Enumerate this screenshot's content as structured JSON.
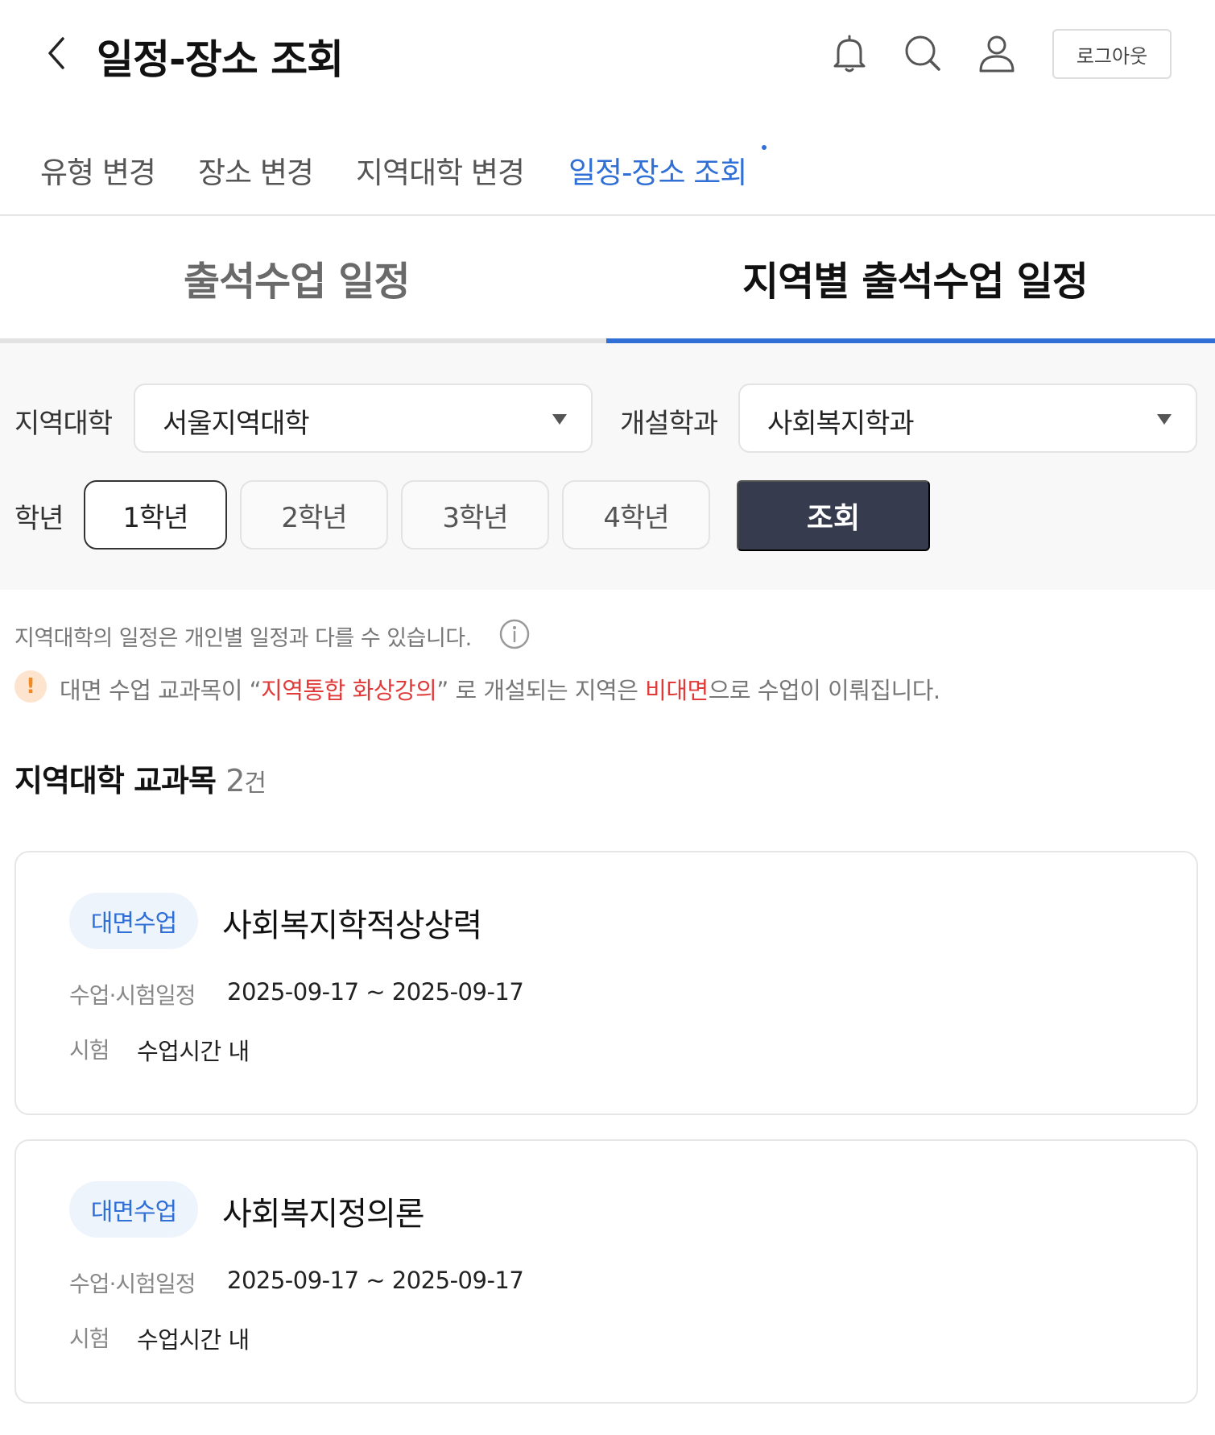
{
  "header": {
    "title": "일정-장소 조회",
    "logout_label": "로그아웃",
    "icons": [
      "back-chevron-icon",
      "bell-icon",
      "search-icon",
      "user-icon"
    ]
  },
  "subnav": {
    "items": [
      {
        "label": "유형 변경",
        "active": false
      },
      {
        "label": "장소 변경",
        "active": false
      },
      {
        "label": "지역대학 변경",
        "active": false
      },
      {
        "label": "일정-장소 조회",
        "active": true
      }
    ]
  },
  "tabs": {
    "items": [
      {
        "label": "출석수업 일정",
        "active": false
      },
      {
        "label": "지역별 출석수업 일정",
        "active": true
      }
    ]
  },
  "filter": {
    "region_label": "지역대학",
    "region_value": "서울지역대학",
    "dept_label": "개설학과",
    "dept_value": "사회복지학과",
    "grade_label": "학년",
    "grades": [
      "1학년",
      "2학년",
      "3학년",
      "4학년"
    ],
    "selected_grade": "1학년",
    "search_label": "조회"
  },
  "notices": {
    "line1": "지역대학의 일정은 개인별 일정과 다를 수 있습니다.",
    "line2_prefix": "대면 수업 교과목이 “",
    "line2_highlight1": "지역통합 화상강의",
    "line2_mid": "” 로 개설되는 지역은 ",
    "line2_highlight2": "비대면",
    "line2_suffix": "으로 수업이 이뤄집니다."
  },
  "section": {
    "title": "지역대학 교과목",
    "count": "2",
    "count_unit": "건"
  },
  "courses": [
    {
      "badge": "대면수업",
      "name": "사회복지학적상상력",
      "schedule_label": "수업·시험일정",
      "schedule_value": "2025-09-17 ~ 2025-09-17",
      "exam_label": "시험",
      "exam_value": "수업시간 내"
    },
    {
      "badge": "대면수업",
      "name": "사회복지정의론",
      "schedule_label": "수업·시험일정",
      "schedule_value": "2025-09-17 ~ 2025-09-17",
      "exam_label": "시험",
      "exam_value": "수업시간 내"
    }
  ],
  "colors": {
    "accent": "#2f6fd6",
    "button_dark": "#363b4d",
    "highlight_red": "#e03b3b",
    "warning_orange": "#f08a24"
  }
}
